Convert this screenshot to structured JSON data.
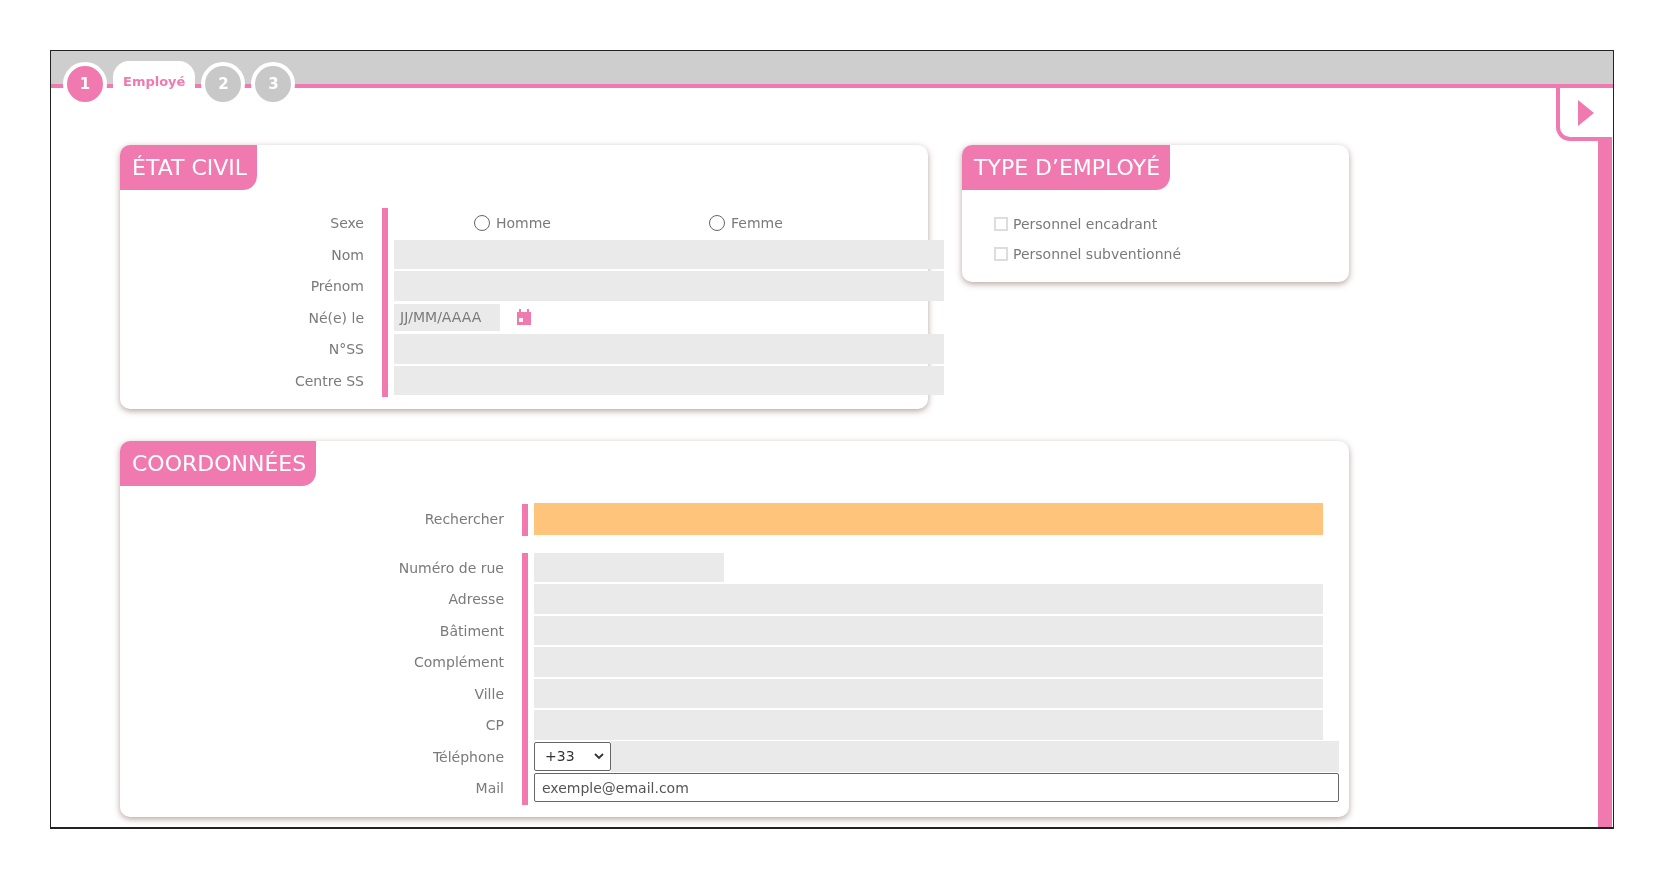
{
  "steps": [
    {
      "number": "1",
      "label": "Employé",
      "selected": true
    },
    {
      "number": "2",
      "selected": false
    },
    {
      "number": "3",
      "selected": false
    }
  ],
  "etat_civil": {
    "title": "ÉTAT CIVIL",
    "fields": [
      {
        "kind": "radio",
        "label": "Sexe",
        "options": [
          {
            "label": "Homme",
            "selected": false
          },
          {
            "label": "Femme",
            "selected": false
          }
        ]
      },
      {
        "kind": "text",
        "label": "Nom"
      },
      {
        "kind": "text",
        "label": "Prénom"
      },
      {
        "kind": "date",
        "label": "Né(e) le",
        "placeholder": "JJ/MM/AAAA"
      },
      {
        "kind": "text",
        "label": "N°SS"
      },
      {
        "kind": "text",
        "label": "Centre SS"
      }
    ]
  },
  "type_employe": {
    "title": "TYPE D’EMPLOYÉ",
    "options": [
      {
        "label": "Personnel encadrant",
        "checked": false
      },
      {
        "label": "Personnel subventionné",
        "checked": false
      }
    ]
  },
  "coordonnees": {
    "title": "COORDONNÉES",
    "search": {
      "label": "Rechercher"
    },
    "fields": [
      {
        "kind": "short",
        "label": "Numéro de rue"
      },
      {
        "kind": "text",
        "label": "Adresse"
      },
      {
        "kind": "text",
        "label": "Bâtiment"
      },
      {
        "kind": "text",
        "label": "Complément"
      },
      {
        "kind": "text",
        "label": "Ville"
      },
      {
        "kind": "text",
        "label": "CP"
      },
      {
        "kind": "tel",
        "label": "Téléphone",
        "prefix": "+33"
      },
      {
        "kind": "email",
        "label": "Mail",
        "placeholder": "exemple@email.com"
      }
    ]
  }
}
